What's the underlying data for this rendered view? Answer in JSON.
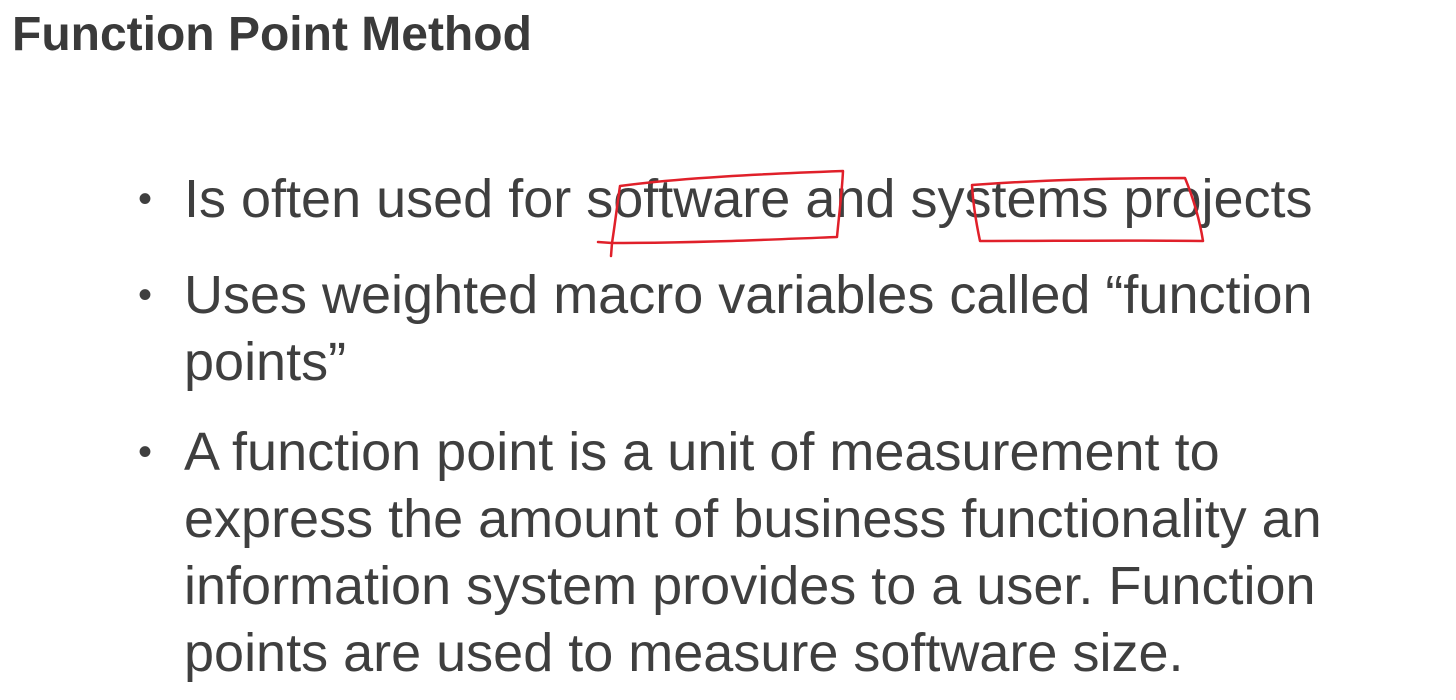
{
  "slide": {
    "title": "Function Point Method",
    "bullets": [
      {
        "lines": [
          {
            "segments": [
              "Is often used for ",
              "software",
              " and ",
              "systems",
              " projects"
            ]
          }
        ]
      },
      {
        "lines": [
          "Uses weighted macro variables called “function",
          "points”"
        ]
      },
      {
        "lines": [
          "A function point is a unit of measurement to",
          "express the amount of business functionality an",
          "information system provides to a user. Function",
          "points are used to measure software size."
        ]
      }
    ],
    "bullet_glyph": "•"
  },
  "annotation": {
    "color": "#e0202a",
    "circled_words": [
      "software",
      "systems"
    ]
  }
}
